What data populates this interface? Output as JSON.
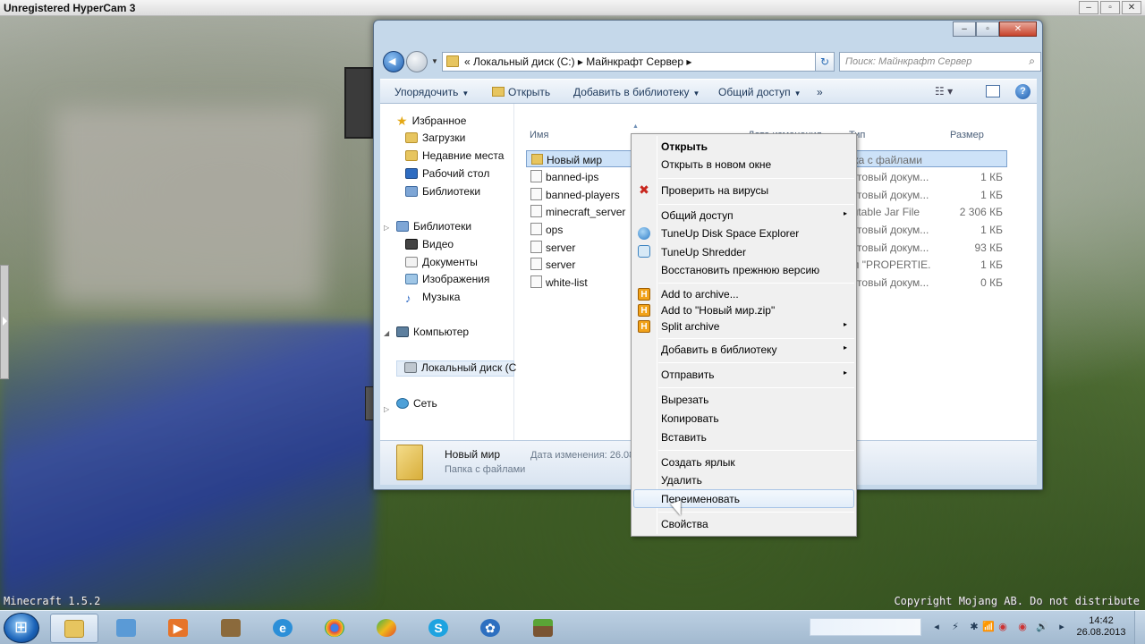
{
  "hypercam": {
    "title": "Unregistered HyperCam 3",
    "min": "–",
    "max": "▫",
    "close": "✕"
  },
  "game": {
    "version": "Minecraft 1.5.2",
    "copyright": "Copyright Mojang AB. Do not distribute"
  },
  "window": {
    "controls": {
      "min": "–",
      "max": "▫",
      "close": "✕"
    },
    "address": {
      "path": "«  Локальный диск (C:)  ▸  Майнкрафт Сервер  ▸",
      "dropdown": "▾"
    },
    "refresh": "↻",
    "search": {
      "placeholder": "Поиск: Майнкрафт Сервер",
      "icon": "search-icon"
    },
    "toolbar": {
      "organize": "Упорядочить",
      "open": "Открыть",
      "add_to_library": "Добавить в библиотеку",
      "share": "Общий доступ",
      "more": "»",
      "view_icon": "☷ ▾",
      "help": "?"
    },
    "nav": {
      "favorites": "Избранное",
      "downloads": "Загрузки",
      "recent": "Недавние места",
      "desktop": "Рабочий стол",
      "libraries_fav": "Библиотеки",
      "libraries": "Библиотеки",
      "video": "Видео",
      "documents": "Документы",
      "images": "Изображения",
      "music": "Музыка",
      "computer": "Компьютер",
      "local_disk": "Локальный диск (С",
      "network": "Сеть"
    },
    "columns": {
      "name": "Имя",
      "date": "Дата изменения",
      "type": "Тип",
      "size": "Размер"
    },
    "files": [
      {
        "name": "Новый мир",
        "type": "апка с файлами",
        "size": "",
        "folder": true
      },
      {
        "name": "banned-ips",
        "type": "екстовый докум...",
        "size": "1 КБ"
      },
      {
        "name": "banned-players",
        "type": "екстовый докум...",
        "size": "1 КБ"
      },
      {
        "name": "minecraft_server",
        "type": "ecutable Jar File",
        "size": "2 306 КБ"
      },
      {
        "name": "ops",
        "type": "екстовый докум...",
        "size": "1 КБ"
      },
      {
        "name": "server",
        "type": "екстовый докум...",
        "size": "93 КБ"
      },
      {
        "name": "server",
        "type": "айл \"PROPERTIE...",
        "size": "1 КБ"
      },
      {
        "name": "white-list",
        "type": "екстовый докум...",
        "size": "0 КБ"
      }
    ],
    "details": {
      "name": "Новый мир",
      "type": "Папка с файлами",
      "date_label": "Дата изменения: 26.08"
    }
  },
  "context_menu": {
    "open": "Открыть",
    "open_new_window": "Открыть в новом окне",
    "scan_virus": "Проверить на вирусы",
    "share": "Общий доступ",
    "tuneup_explorer": "TuneUp Disk Space Explorer",
    "tuneup_shredder": "TuneUp Shredder",
    "restore_prev": "Восстановить прежнюю версию",
    "add_archive": "Add to archive...",
    "add_zip": "Add to \"Новый мир.zip\"",
    "split_archive": "Split archive",
    "add_library": "Добавить в библиотеку",
    "send_to": "Отправить",
    "cut": "Вырезать",
    "copy": "Копировать",
    "paste": "Вставить",
    "create_shortcut": "Создать ярлык",
    "delete": "Удалить",
    "rename": "Переименовать",
    "properties": "Свойства",
    "submenu_arrow": "▸",
    "av_icon": "✖",
    "hz_icon": "H"
  },
  "taskbar": {
    "clock_time": "14:42",
    "clock_date": "26.08.2013",
    "tray_icons": [
      "◂",
      "⚡",
      "✱",
      "📶",
      "◉",
      "◉",
      "🔊",
      "▸"
    ]
  }
}
